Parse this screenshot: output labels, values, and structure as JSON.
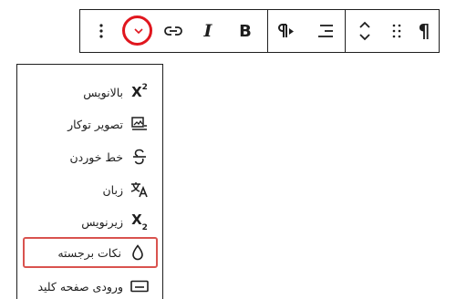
{
  "toolbar": {
    "more_options_icon": "vertical-ellipsis",
    "dropdown_icon": "chevron-down",
    "link_icon": "link",
    "italic_label": "I",
    "bold_label": "B",
    "paragraph_direction_icon": "paragraph-rtl",
    "align_icon": "align-right",
    "move_icon": "chevron-up-down",
    "drag_icon": "drag-dots",
    "paragraph_label": "¶",
    "highlight_color": "#e0161e"
  },
  "menu": {
    "items": [
      {
        "label": "بالانویس",
        "icon": "superscript",
        "icon_text": "X",
        "icon_script": "2"
      },
      {
        "label": "تصویر توکار",
        "icon": "inline-image"
      },
      {
        "label": "خط خوردن",
        "icon": "strikethrough"
      },
      {
        "label": "زبان",
        "icon": "language"
      },
      {
        "label": "زیرنویس",
        "icon": "subscript",
        "icon_text": "X",
        "icon_script": "2"
      },
      {
        "label": "نکات برجسته",
        "icon": "highlighter",
        "highlighted": true
      },
      {
        "label": "ورودی صفحه کلید",
        "icon": "keyboard-input"
      }
    ],
    "highlight_border_color": "#d9534f"
  }
}
